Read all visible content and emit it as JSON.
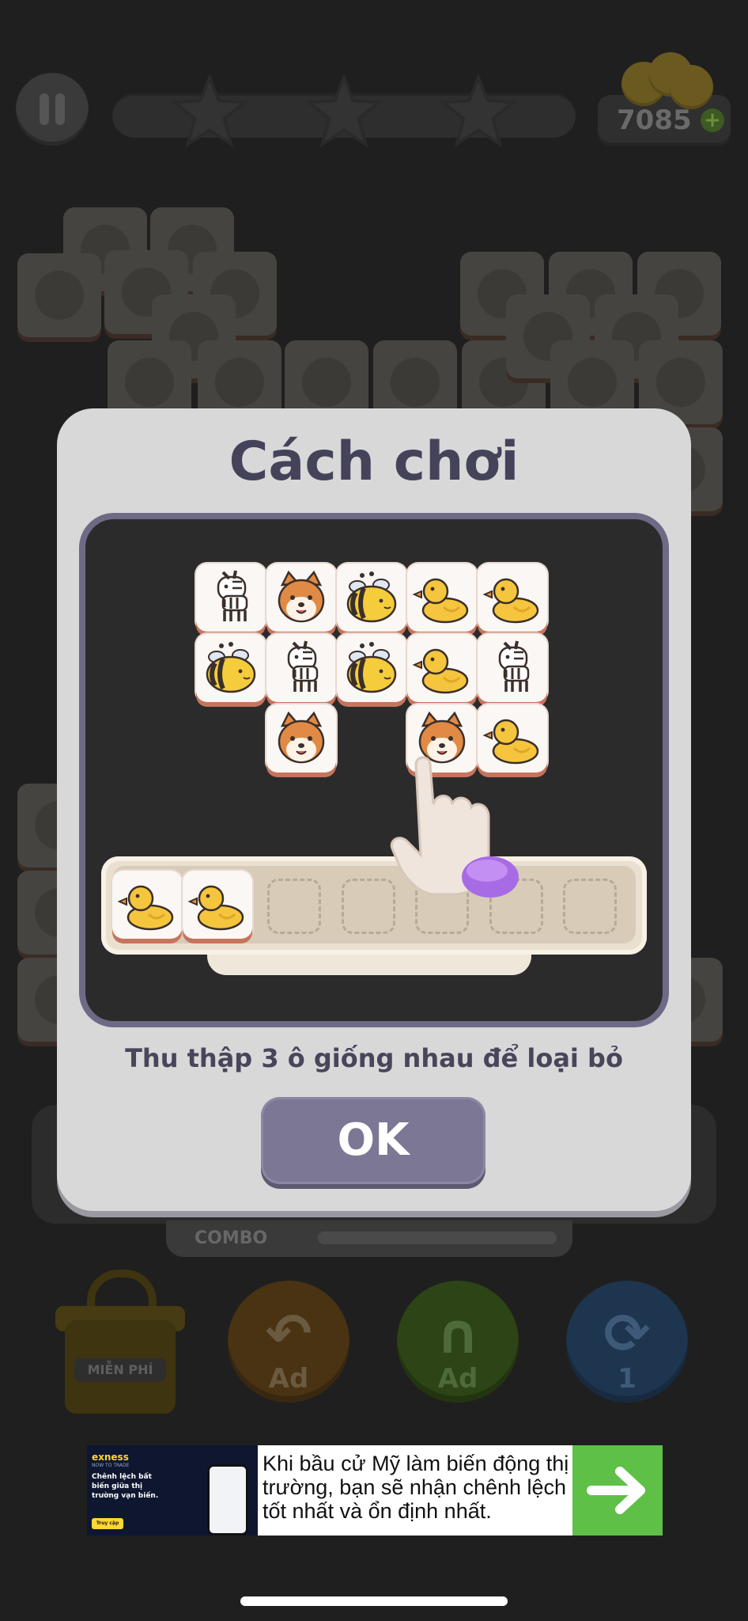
{
  "hud": {
    "coins": "7085",
    "stars_total": 3
  },
  "modal": {
    "title": "Cách chơi",
    "instruction": "Thu thập 3 ô giống nhau để loại bỏ",
    "ok_label": "OK",
    "demo_board": [
      [
        "zebra",
        "shiba",
        "bee",
        "duck",
        "duck"
      ],
      [
        "bee",
        "zebra",
        "bee",
        "duck",
        "zebra"
      ],
      [
        null,
        "shiba",
        null,
        "shiba",
        "duck"
      ]
    ],
    "tray_tiles": [
      "duck",
      "duck"
    ],
    "tray_slots": 7
  },
  "bottom": {
    "combo_label": "COMBO",
    "gift_label": "MIỄN PHÍ",
    "undo_label": "Ad",
    "magnet_label": "Ad",
    "shuffle_count": "1"
  },
  "ad": {
    "brand": "exness",
    "brand_sub": "NOW TO TRADE",
    "headline": "Chênh lệch bất biến giữa thị trường vạn biến.",
    "cta": "Truy cập",
    "text": "Khi bầu cử Mỹ làm biến động thị trường, bạn sẽ nhận chênh lệch tốt nhất và ổn định nhất."
  },
  "colors": {
    "modal_bg": "#d9d8d9",
    "title": "#45435a",
    "ok_button": "#7b7794",
    "demo_border": "#6e6a86",
    "ad_arrow": "#5ec046"
  }
}
